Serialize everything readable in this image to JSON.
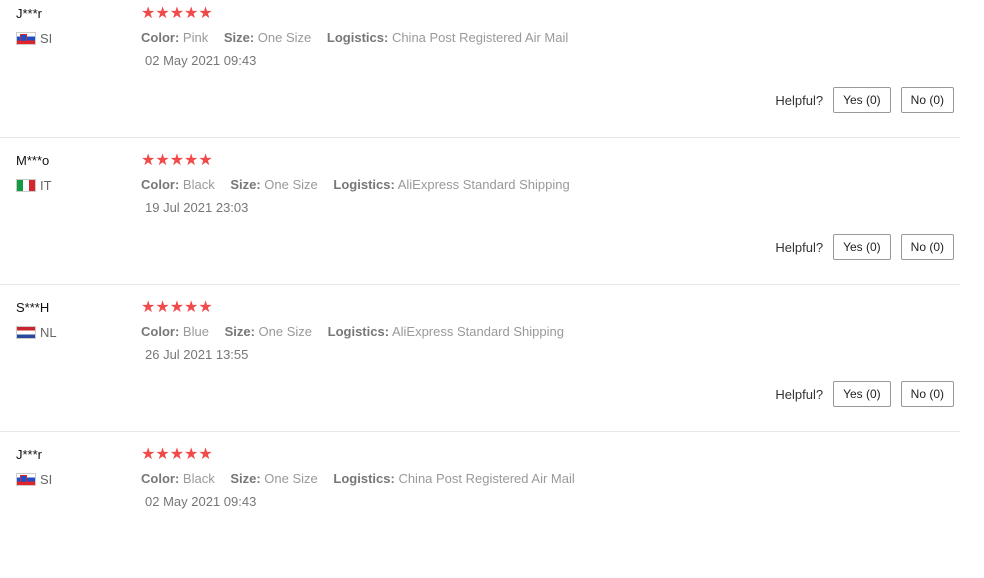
{
  "helpful_label": "Helpful?",
  "colors": {
    "star": "#f04a4a",
    "divider": "#e8e8e8"
  },
  "reviews": [
    {
      "user": "J***r",
      "country": "SI",
      "flag": "flag-slovenia-icon",
      "stars": "★★★★★",
      "color_label": "Color:",
      "color": "Pink",
      "size_label": "Size:",
      "size": "One Size",
      "logistics_label": "Logistics:",
      "logistics": "China Post Registered Air Mail",
      "date": "02 May 2021 09:43",
      "yes": "Yes (0)",
      "no": "No (0)"
    },
    {
      "user": "M***o",
      "country": "IT",
      "flag": "flag-italy-icon",
      "stars": "★★★★★",
      "color_label": "Color:",
      "color": "Black",
      "size_label": "Size:",
      "size": "One Size",
      "logistics_label": "Logistics:",
      "logistics": "AliExpress Standard Shipping",
      "date": "19 Jul 2021 23:03",
      "yes": "Yes (0)",
      "no": "No (0)"
    },
    {
      "user": "S***H",
      "country": "NL",
      "flag": "flag-netherlands-icon",
      "stars": "★★★★★",
      "color_label": "Color:",
      "color": "Blue",
      "size_label": "Size:",
      "size": "One Size",
      "logistics_label": "Logistics:",
      "logistics": "AliExpress Standard Shipping",
      "date": "26 Jul 2021 13:55",
      "yes": "Yes (0)",
      "no": "No (0)"
    },
    {
      "user": "J***r",
      "country": "SI",
      "flag": "flag-slovenia-icon",
      "stars": "★★★★★",
      "color_label": "Color:",
      "color": "Black",
      "size_label": "Size:",
      "size": "One Size",
      "logistics_label": "Logistics:",
      "logistics": "China Post Registered Air Mail",
      "date": "02 May 2021 09:43"
    }
  ]
}
